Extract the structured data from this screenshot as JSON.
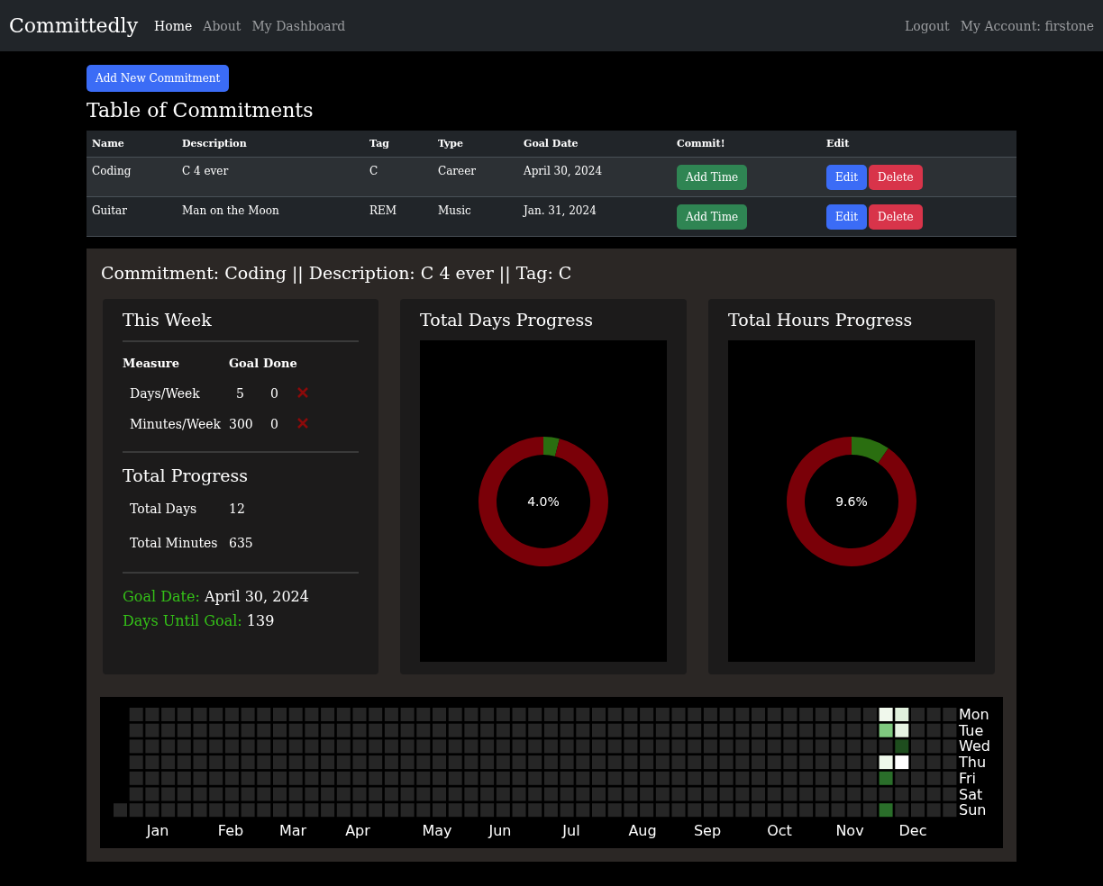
{
  "navbar": {
    "brand": "Committedly",
    "links": [
      {
        "label": "Home",
        "selected": true
      },
      {
        "label": "About",
        "selected": false
      },
      {
        "label": "My Dashboard",
        "selected": false
      }
    ],
    "right_links": [
      "Logout",
      "My Account: firstone"
    ]
  },
  "add_button": "Add New Commitment",
  "table_title": "Table of Commitments",
  "table": {
    "columns": [
      "Name",
      "Description",
      "Tag",
      "Type",
      "Goal Date",
      "Commit!",
      "Edit"
    ],
    "rows": [
      {
        "name": "Coding",
        "description": "C 4 ever",
        "tag": "C",
        "type": "Career",
        "goal_date": "April 30, 2024",
        "commit_button": "Add Time",
        "edit_button": "Edit",
        "delete_button": "Delete"
      },
      {
        "name": "Guitar",
        "description": "Man on the Moon",
        "tag": "REM",
        "type": "Music",
        "goal_date": "Jan. 31, 2024",
        "commit_button": "Add Time",
        "edit_button": "Edit",
        "delete_button": "Delete"
      }
    ]
  },
  "detail": {
    "title": "Commitment: Coding || Description: C 4 ever || Tag: C",
    "this_week": {
      "title": "This Week",
      "columns": [
        "Measure",
        "Goal",
        "Done"
      ],
      "rows": [
        {
          "measure": "Days/Week",
          "goal": "5",
          "done": "0",
          "met": false
        },
        {
          "measure": "Minutes/Week",
          "goal": "300",
          "done": "0",
          "met": false
        }
      ]
    },
    "total_progress": {
      "title": "Total Progress",
      "rows": [
        {
          "label": "Total Days",
          "value": "12"
        },
        {
          "label": "Total Minutes",
          "value": "635"
        }
      ]
    },
    "goal_date": {
      "label": "Goal Date:",
      "value": "April 30, 2024"
    },
    "days_until_goal": {
      "label": "Days Until Goal:",
      "value": "139"
    },
    "charts": [
      {
        "title": "Total Days Progress",
        "center_label": "4.0%",
        "chart_data": {
          "type": "donut",
          "values": [
            4.0,
            96.0
          ]
        }
      },
      {
        "title": "Total Hours Progress",
        "center_label": "9.6%",
        "chart_data": {
          "type": "donut",
          "values": [
            9.6,
            90.4
          ]
        }
      }
    ],
    "heatmap": {
      "day_labels": [
        "Mon",
        "Tue",
        "Wed",
        "Thu",
        "Fri",
        "Sat",
        "Sun"
      ],
      "month_labels": [
        "Jan",
        "Feb",
        "Mar",
        "Apr",
        "May",
        "Jun",
        "Jul",
        "Aug",
        "Sep",
        "Oct",
        "Nov",
        "Dec"
      ],
      "weeks": [
        {
          "cells": [
            null,
            null,
            null,
            null,
            null,
            null,
            {
              "color": "#262626"
            }
          ]
        },
        {
          "cells": [
            {
              "color": "#262626"
            },
            {
              "color": "#262626"
            },
            {
              "color": "#262626"
            },
            {
              "color": "#262626"
            },
            {
              "color": "#262626"
            },
            {
              "color": "#262626"
            },
            {
              "color": "#262626"
            }
          ]
        },
        {
          "cells": [
            {
              "color": "#262626"
            },
            {
              "color": "#262626"
            },
            {
              "color": "#262626"
            },
            {
              "color": "#262626"
            },
            {
              "color": "#262626"
            },
            {
              "color": "#262626"
            },
            {
              "color": "#262626"
            }
          ]
        },
        {
          "cells": [
            {
              "color": "#262626"
            },
            {
              "color": "#262626"
            },
            {
              "color": "#262626"
            },
            {
              "color": "#262626"
            },
            {
              "color": "#262626"
            },
            {
              "color": "#262626"
            },
            {
              "color": "#262626"
            }
          ]
        },
        {
          "cells": [
            {
              "color": "#262626"
            },
            {
              "color": "#262626"
            },
            {
              "color": "#262626"
            },
            {
              "color": "#262626"
            },
            {
              "color": "#262626"
            },
            {
              "color": "#262626"
            },
            {
              "color": "#262626"
            }
          ]
        },
        {
          "cells": [
            {
              "color": "#262626"
            },
            {
              "color": "#262626"
            },
            {
              "color": "#262626"
            },
            {
              "color": "#262626"
            },
            {
              "color": "#262626"
            },
            {
              "color": "#262626"
            },
            {
              "color": "#262626"
            }
          ]
        },
        {
          "cells": [
            {
              "color": "#262626"
            },
            {
              "color": "#262626"
            },
            {
              "color": "#262626"
            },
            {
              "color": "#262626"
            },
            {
              "color": "#262626"
            },
            {
              "color": "#262626"
            },
            {
              "color": "#262626"
            }
          ]
        },
        {
          "cells": [
            {
              "color": "#262626"
            },
            {
              "color": "#262626"
            },
            {
              "color": "#262626"
            },
            {
              "color": "#262626"
            },
            {
              "color": "#262626"
            },
            {
              "color": "#262626"
            },
            {
              "color": "#262626"
            }
          ]
        },
        {
          "cells": [
            {
              "color": "#262626"
            },
            {
              "color": "#262626"
            },
            {
              "color": "#262626"
            },
            {
              "color": "#262626"
            },
            {
              "color": "#262626"
            },
            {
              "color": "#262626"
            },
            {
              "color": "#262626"
            }
          ]
        },
        {
          "cells": [
            {
              "color": "#262626"
            },
            {
              "color": "#262626"
            },
            {
              "color": "#262626"
            },
            {
              "color": "#262626"
            },
            {
              "color": "#262626"
            },
            {
              "color": "#262626"
            },
            {
              "color": "#262626"
            }
          ]
        },
        {
          "cells": [
            {
              "color": "#262626"
            },
            {
              "color": "#262626"
            },
            {
              "color": "#262626"
            },
            {
              "color": "#262626"
            },
            {
              "color": "#262626"
            },
            {
              "color": "#262626"
            },
            {
              "color": "#262626"
            }
          ]
        },
        {
          "cells": [
            {
              "color": "#262626"
            },
            {
              "color": "#262626"
            },
            {
              "color": "#262626"
            },
            {
              "color": "#262626"
            },
            {
              "color": "#262626"
            },
            {
              "color": "#262626"
            },
            {
              "color": "#262626"
            }
          ]
        },
        {
          "cells": [
            {
              "color": "#262626"
            },
            {
              "color": "#262626"
            },
            {
              "color": "#262626"
            },
            {
              "color": "#262626"
            },
            {
              "color": "#262626"
            },
            {
              "color": "#262626"
            },
            {
              "color": "#262626"
            }
          ]
        },
        {
          "cells": [
            {
              "color": "#262626"
            },
            {
              "color": "#262626"
            },
            {
              "color": "#262626"
            },
            {
              "color": "#262626"
            },
            {
              "color": "#262626"
            },
            {
              "color": "#262626"
            },
            {
              "color": "#262626"
            }
          ]
        },
        {
          "cells": [
            {
              "color": "#262626"
            },
            {
              "color": "#262626"
            },
            {
              "color": "#262626"
            },
            {
              "color": "#262626"
            },
            {
              "color": "#262626"
            },
            {
              "color": "#262626"
            },
            {
              "color": "#262626"
            }
          ]
        },
        {
          "cells": [
            {
              "color": "#262626"
            },
            {
              "color": "#262626"
            },
            {
              "color": "#262626"
            },
            {
              "color": "#262626"
            },
            {
              "color": "#262626"
            },
            {
              "color": "#262626"
            },
            {
              "color": "#262626"
            }
          ]
        },
        {
          "cells": [
            {
              "color": "#262626"
            },
            {
              "color": "#262626"
            },
            {
              "color": "#262626"
            },
            {
              "color": "#262626"
            },
            {
              "color": "#262626"
            },
            {
              "color": "#262626"
            },
            {
              "color": "#262626"
            }
          ]
        },
        {
          "cells": [
            {
              "color": "#262626"
            },
            {
              "color": "#262626"
            },
            {
              "color": "#262626"
            },
            {
              "color": "#262626"
            },
            {
              "color": "#262626"
            },
            {
              "color": "#262626"
            },
            {
              "color": "#262626"
            }
          ]
        },
        {
          "cells": [
            {
              "color": "#262626"
            },
            {
              "color": "#262626"
            },
            {
              "color": "#262626"
            },
            {
              "color": "#262626"
            },
            {
              "color": "#262626"
            },
            {
              "color": "#262626"
            },
            {
              "color": "#262626"
            }
          ]
        },
        {
          "cells": [
            {
              "color": "#262626"
            },
            {
              "color": "#262626"
            },
            {
              "color": "#262626"
            },
            {
              "color": "#262626"
            },
            {
              "color": "#262626"
            },
            {
              "color": "#262626"
            },
            {
              "color": "#262626"
            }
          ]
        },
        {
          "cells": [
            {
              "color": "#262626"
            },
            {
              "color": "#262626"
            },
            {
              "color": "#262626"
            },
            {
              "color": "#262626"
            },
            {
              "color": "#262626"
            },
            {
              "color": "#262626"
            },
            {
              "color": "#262626"
            }
          ]
        },
        {
          "cells": [
            {
              "color": "#262626"
            },
            {
              "color": "#262626"
            },
            {
              "color": "#262626"
            },
            {
              "color": "#262626"
            },
            {
              "color": "#262626"
            },
            {
              "color": "#262626"
            },
            {
              "color": "#262626"
            }
          ]
        },
        {
          "cells": [
            {
              "color": "#262626"
            },
            {
              "color": "#262626"
            },
            {
              "color": "#262626"
            },
            {
              "color": "#262626"
            },
            {
              "color": "#262626"
            },
            {
              "color": "#262626"
            },
            {
              "color": "#262626"
            }
          ]
        },
        {
          "cells": [
            {
              "color": "#262626"
            },
            {
              "color": "#262626"
            },
            {
              "color": "#262626"
            },
            {
              "color": "#262626"
            },
            {
              "color": "#262626"
            },
            {
              "color": "#262626"
            },
            {
              "color": "#262626"
            }
          ]
        },
        {
          "cells": [
            {
              "color": "#262626"
            },
            {
              "color": "#262626"
            },
            {
              "color": "#262626"
            },
            {
              "color": "#262626"
            },
            {
              "color": "#262626"
            },
            {
              "color": "#262626"
            },
            {
              "color": "#262626"
            }
          ]
        },
        {
          "cells": [
            {
              "color": "#262626"
            },
            {
              "color": "#262626"
            },
            {
              "color": "#262626"
            },
            {
              "color": "#262626"
            },
            {
              "color": "#262626"
            },
            {
              "color": "#262626"
            },
            {
              "color": "#262626"
            }
          ]
        },
        {
          "cells": [
            {
              "color": "#262626"
            },
            {
              "color": "#262626"
            },
            {
              "color": "#262626"
            },
            {
              "color": "#262626"
            },
            {
              "color": "#262626"
            },
            {
              "color": "#262626"
            },
            {
              "color": "#262626"
            }
          ]
        },
        {
          "cells": [
            {
              "color": "#262626"
            },
            {
              "color": "#262626"
            },
            {
              "color": "#262626"
            },
            {
              "color": "#262626"
            },
            {
              "color": "#262626"
            },
            {
              "color": "#262626"
            },
            {
              "color": "#262626"
            }
          ]
        },
        {
          "cells": [
            {
              "color": "#262626"
            },
            {
              "color": "#262626"
            },
            {
              "color": "#262626"
            },
            {
              "color": "#262626"
            },
            {
              "color": "#262626"
            },
            {
              "color": "#262626"
            },
            {
              "color": "#262626"
            }
          ]
        },
        {
          "cells": [
            {
              "color": "#262626"
            },
            {
              "color": "#262626"
            },
            {
              "color": "#262626"
            },
            {
              "color": "#262626"
            },
            {
              "color": "#262626"
            },
            {
              "color": "#262626"
            },
            {
              "color": "#262626"
            }
          ]
        },
        {
          "cells": [
            {
              "color": "#262626"
            },
            {
              "color": "#262626"
            },
            {
              "color": "#262626"
            },
            {
              "color": "#262626"
            },
            {
              "color": "#262626"
            },
            {
              "color": "#262626"
            },
            {
              "color": "#262626"
            }
          ]
        },
        {
          "cells": [
            {
              "color": "#262626"
            },
            {
              "color": "#262626"
            },
            {
              "color": "#262626"
            },
            {
              "color": "#262626"
            },
            {
              "color": "#262626"
            },
            {
              "color": "#262626"
            },
            {
              "color": "#262626"
            }
          ]
        },
        {
          "cells": [
            {
              "color": "#262626"
            },
            {
              "color": "#262626"
            },
            {
              "color": "#262626"
            },
            {
              "color": "#262626"
            },
            {
              "color": "#262626"
            },
            {
              "color": "#262626"
            },
            {
              "color": "#262626"
            }
          ]
        },
        {
          "cells": [
            {
              "color": "#262626"
            },
            {
              "color": "#262626"
            },
            {
              "color": "#262626"
            },
            {
              "color": "#262626"
            },
            {
              "color": "#262626"
            },
            {
              "color": "#262626"
            },
            {
              "color": "#262626"
            }
          ]
        },
        {
          "cells": [
            {
              "color": "#262626"
            },
            {
              "color": "#262626"
            },
            {
              "color": "#262626"
            },
            {
              "color": "#262626"
            },
            {
              "color": "#262626"
            },
            {
              "color": "#262626"
            },
            {
              "color": "#262626"
            }
          ]
        },
        {
          "cells": [
            {
              "color": "#262626"
            },
            {
              "color": "#262626"
            },
            {
              "color": "#262626"
            },
            {
              "color": "#262626"
            },
            {
              "color": "#262626"
            },
            {
              "color": "#262626"
            },
            {
              "color": "#262626"
            }
          ]
        },
        {
          "cells": [
            {
              "color": "#262626"
            },
            {
              "color": "#262626"
            },
            {
              "color": "#262626"
            },
            {
              "color": "#262626"
            },
            {
              "color": "#262626"
            },
            {
              "color": "#262626"
            },
            {
              "color": "#262626"
            }
          ]
        },
        {
          "cells": [
            {
              "color": "#262626"
            },
            {
              "color": "#262626"
            },
            {
              "color": "#262626"
            },
            {
              "color": "#262626"
            },
            {
              "color": "#262626"
            },
            {
              "color": "#262626"
            },
            {
              "color": "#262626"
            }
          ]
        },
        {
          "cells": [
            {
              "color": "#262626"
            },
            {
              "color": "#262626"
            },
            {
              "color": "#262626"
            },
            {
              "color": "#262626"
            },
            {
              "color": "#262626"
            },
            {
              "color": "#262626"
            },
            {
              "color": "#262626"
            }
          ]
        },
        {
          "cells": [
            {
              "color": "#262626"
            },
            {
              "color": "#262626"
            },
            {
              "color": "#262626"
            },
            {
              "color": "#262626"
            },
            {
              "color": "#262626"
            },
            {
              "color": "#262626"
            },
            {
              "color": "#262626"
            }
          ]
        },
        {
          "cells": [
            {
              "color": "#262626"
            },
            {
              "color": "#262626"
            },
            {
              "color": "#262626"
            },
            {
              "color": "#262626"
            },
            {
              "color": "#262626"
            },
            {
              "color": "#262626"
            },
            {
              "color": "#262626"
            }
          ]
        },
        {
          "cells": [
            {
              "color": "#262626"
            },
            {
              "color": "#262626"
            },
            {
              "color": "#262626"
            },
            {
              "color": "#262626"
            },
            {
              "color": "#262626"
            },
            {
              "color": "#262626"
            },
            {
              "color": "#262626"
            }
          ]
        },
        {
          "cells": [
            {
              "color": "#262626"
            },
            {
              "color": "#262626"
            },
            {
              "color": "#262626"
            },
            {
              "color": "#262626"
            },
            {
              "color": "#262626"
            },
            {
              "color": "#262626"
            },
            {
              "color": "#262626"
            }
          ]
        },
        {
          "cells": [
            {
              "color": "#262626"
            },
            {
              "color": "#262626"
            },
            {
              "color": "#262626"
            },
            {
              "color": "#262626"
            },
            {
              "color": "#262626"
            },
            {
              "color": "#262626"
            },
            {
              "color": "#262626"
            }
          ]
        },
        {
          "cells": [
            {
              "color": "#262626"
            },
            {
              "color": "#262626"
            },
            {
              "color": "#262626"
            },
            {
              "color": "#262626"
            },
            {
              "color": "#262626"
            },
            {
              "color": "#262626"
            },
            {
              "color": "#262626"
            }
          ]
        },
        {
          "cells": [
            {
              "color": "#262626"
            },
            {
              "color": "#262626"
            },
            {
              "color": "#262626"
            },
            {
              "color": "#262626"
            },
            {
              "color": "#262626"
            },
            {
              "color": "#262626"
            },
            {
              "color": "#262626"
            }
          ]
        },
        {
          "cells": [
            {
              "color": "#262626"
            },
            {
              "color": "#262626"
            },
            {
              "color": "#262626"
            },
            {
              "color": "#262626"
            },
            {
              "color": "#262626"
            },
            {
              "color": "#262626"
            },
            {
              "color": "#262626"
            }
          ]
        },
        {
          "cells": [
            {
              "color": "#262626"
            },
            {
              "color": "#262626"
            },
            {
              "color": "#262626"
            },
            {
              "color": "#262626"
            },
            {
              "color": "#262626"
            },
            {
              "color": "#262626"
            },
            {
              "color": "#262626"
            }
          ]
        },
        {
          "cells": [
            {
              "color": "#f0f8ec"
            },
            {
              "color": "#7fc97f"
            },
            {
              "color": "#262626"
            },
            {
              "color": "#eef8ea"
            },
            {
              "color": "#2a6e2a"
            },
            {
              "color": "#262626"
            },
            {
              "color": "#2a6e2a"
            }
          ]
        },
        {
          "cells": [
            {
              "color": "#e0f0dc"
            },
            {
              "color": "#e6f4e2"
            },
            {
              "color": "#1e4d1e"
            },
            {
              "color": "#ffffff"
            },
            {
              "color": "#262626"
            },
            {
              "color": "#262626"
            },
            {
              "color": "#262626"
            }
          ]
        },
        {
          "cells": [
            {
              "color": "#262626"
            },
            {
              "color": "#262626"
            },
            {
              "color": "#262626"
            },
            {
              "color": "#262626"
            },
            {
              "color": "#262626"
            },
            {
              "color": "#262626"
            },
            {
              "color": "#262626"
            }
          ]
        },
        {
          "cells": [
            {
              "color": "#262626"
            },
            {
              "color": "#262626"
            },
            {
              "color": "#262626"
            },
            {
              "color": "#262626"
            },
            {
              "color": "#262626"
            },
            {
              "color": "#262626"
            },
            {
              "color": "#262626"
            }
          ]
        },
        {
          "cells": [
            {
              "color": "#262626"
            },
            {
              "color": "#262626"
            },
            {
              "color": "#262626"
            },
            {
              "color": "#262626"
            },
            {
              "color": "#262626"
            },
            {
              "color": "#262626"
            },
            {
              "color": "#262626"
            }
          ]
        }
      ]
    }
  }
}
